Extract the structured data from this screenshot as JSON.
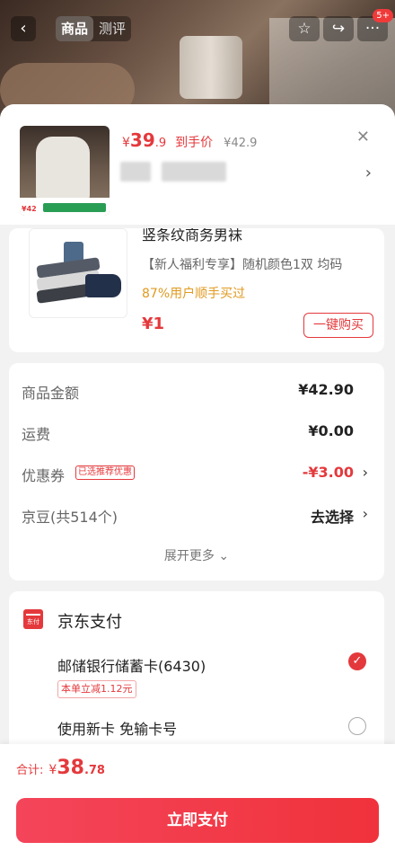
{
  "header": {
    "back_icon": "chevron-left-icon",
    "tabs": [
      {
        "label": "商品",
        "active": true
      },
      {
        "label": "测评",
        "active": false
      }
    ],
    "right_icons": [
      "star-icon",
      "share-icon",
      "more-icon"
    ],
    "message_badge": "5+"
  },
  "product": {
    "thumb_price": "¥42",
    "price_symbol": "¥",
    "price_integer": "39",
    "price_decimal": ".9",
    "price_label": "到手价",
    "original_price": "¥42.9"
  },
  "gift": {
    "title": "竖条纹商务男袜",
    "description": "【新人福利专享】随机颜色1双 均码",
    "note": "87%用户顺手买过",
    "price": "¥1",
    "buy_label": "一键购买"
  },
  "summary": {
    "rows": [
      {
        "label": "商品金额",
        "value": "¥42.90"
      },
      {
        "label": "运费",
        "value": "¥0.00"
      },
      {
        "label": "优惠券",
        "tag": "已选推荐优惠",
        "value": "-¥3.00"
      },
      {
        "label": "京豆(共514个)",
        "value": "去选择"
      }
    ],
    "expand_label": "展开更多"
  },
  "payment": {
    "icon_text": "东付",
    "title": "京东支付",
    "card_name": "邮储银行储蓄卡(6430)",
    "card_discount": "本单立减1.12元",
    "new_card": "使用新卡 免输卡号"
  },
  "footer": {
    "total_label": "合计:",
    "total_symbol": "¥",
    "total_integer": "38",
    "total_decimal": ".78",
    "pay_button": "立即支付"
  },
  "colors": {
    "accent": "#e4393c",
    "note": "#e09a20"
  }
}
